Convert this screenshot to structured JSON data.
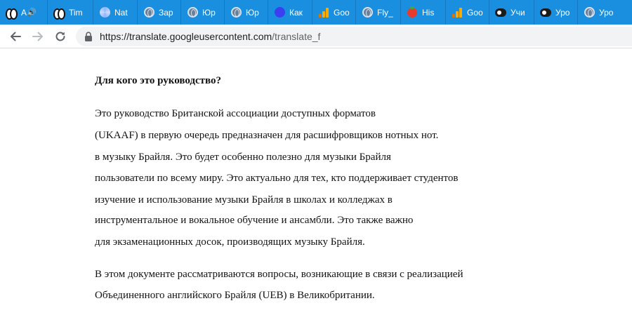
{
  "browser": {
    "tabs": [
      {
        "favicon": "abc-news-icon",
        "title": "ABC",
        "audio": "speaker-icon"
      },
      {
        "favicon": "abc-news-icon",
        "title": "Tim"
      },
      {
        "favicon": "nat-icon",
        "title": "Nat"
      },
      {
        "favicon": "globe-icon",
        "title": "Зар"
      },
      {
        "favicon": "globe-icon",
        "title": "Юр"
      },
      {
        "favicon": "globe-icon",
        "title": "Юр"
      },
      {
        "favicon": "blue-circle-icon",
        "title": "Как"
      },
      {
        "favicon": "analytics-icon",
        "title": "Goo"
      },
      {
        "favicon": "globe-icon",
        "title": "Fly_"
      },
      {
        "favicon": "tomato-icon",
        "title": "His"
      },
      {
        "favicon": "analytics-icon",
        "title": "Goo"
      },
      {
        "favicon": "dark-pill-icon",
        "title": "Учи"
      },
      {
        "favicon": "dark-pill-icon",
        "title": "Уро"
      },
      {
        "favicon": "globe-icon",
        "title": "Уро"
      }
    ],
    "url_host": "https://translate.googleusercontent.com",
    "url_path": "/translate_f",
    "colors": {
      "tabstrip": "#1a8fe0",
      "omnibox": "#f1f3f4"
    }
  },
  "document": {
    "heading": "Для кого это руководство?",
    "paragraph1": [
      "Это руководство Британской ассоциации доступных форматов",
      "(UKAAF) в первую очередь предназначен для расшифровщиков нотных нот.",
      "в музыку Брайля. Это будет особенно полезно для музыки Брайля",
      "пользователи по всему миру. Это актуально для тех, кто поддерживает студентов",
      "изучение и использование музыки Брайля в школах и колледжах в",
      "инструментальное и вокальное обучение и ансамбли. Это также важно",
      "для экзаменационных досок, производящих музыку Брайля."
    ],
    "paragraph2": [
      "В этом документе рассматриваются вопросы, возникающие в связи с реализацией",
      "Объединенного английского Брайля (UEB) в Великобритании."
    ]
  }
}
